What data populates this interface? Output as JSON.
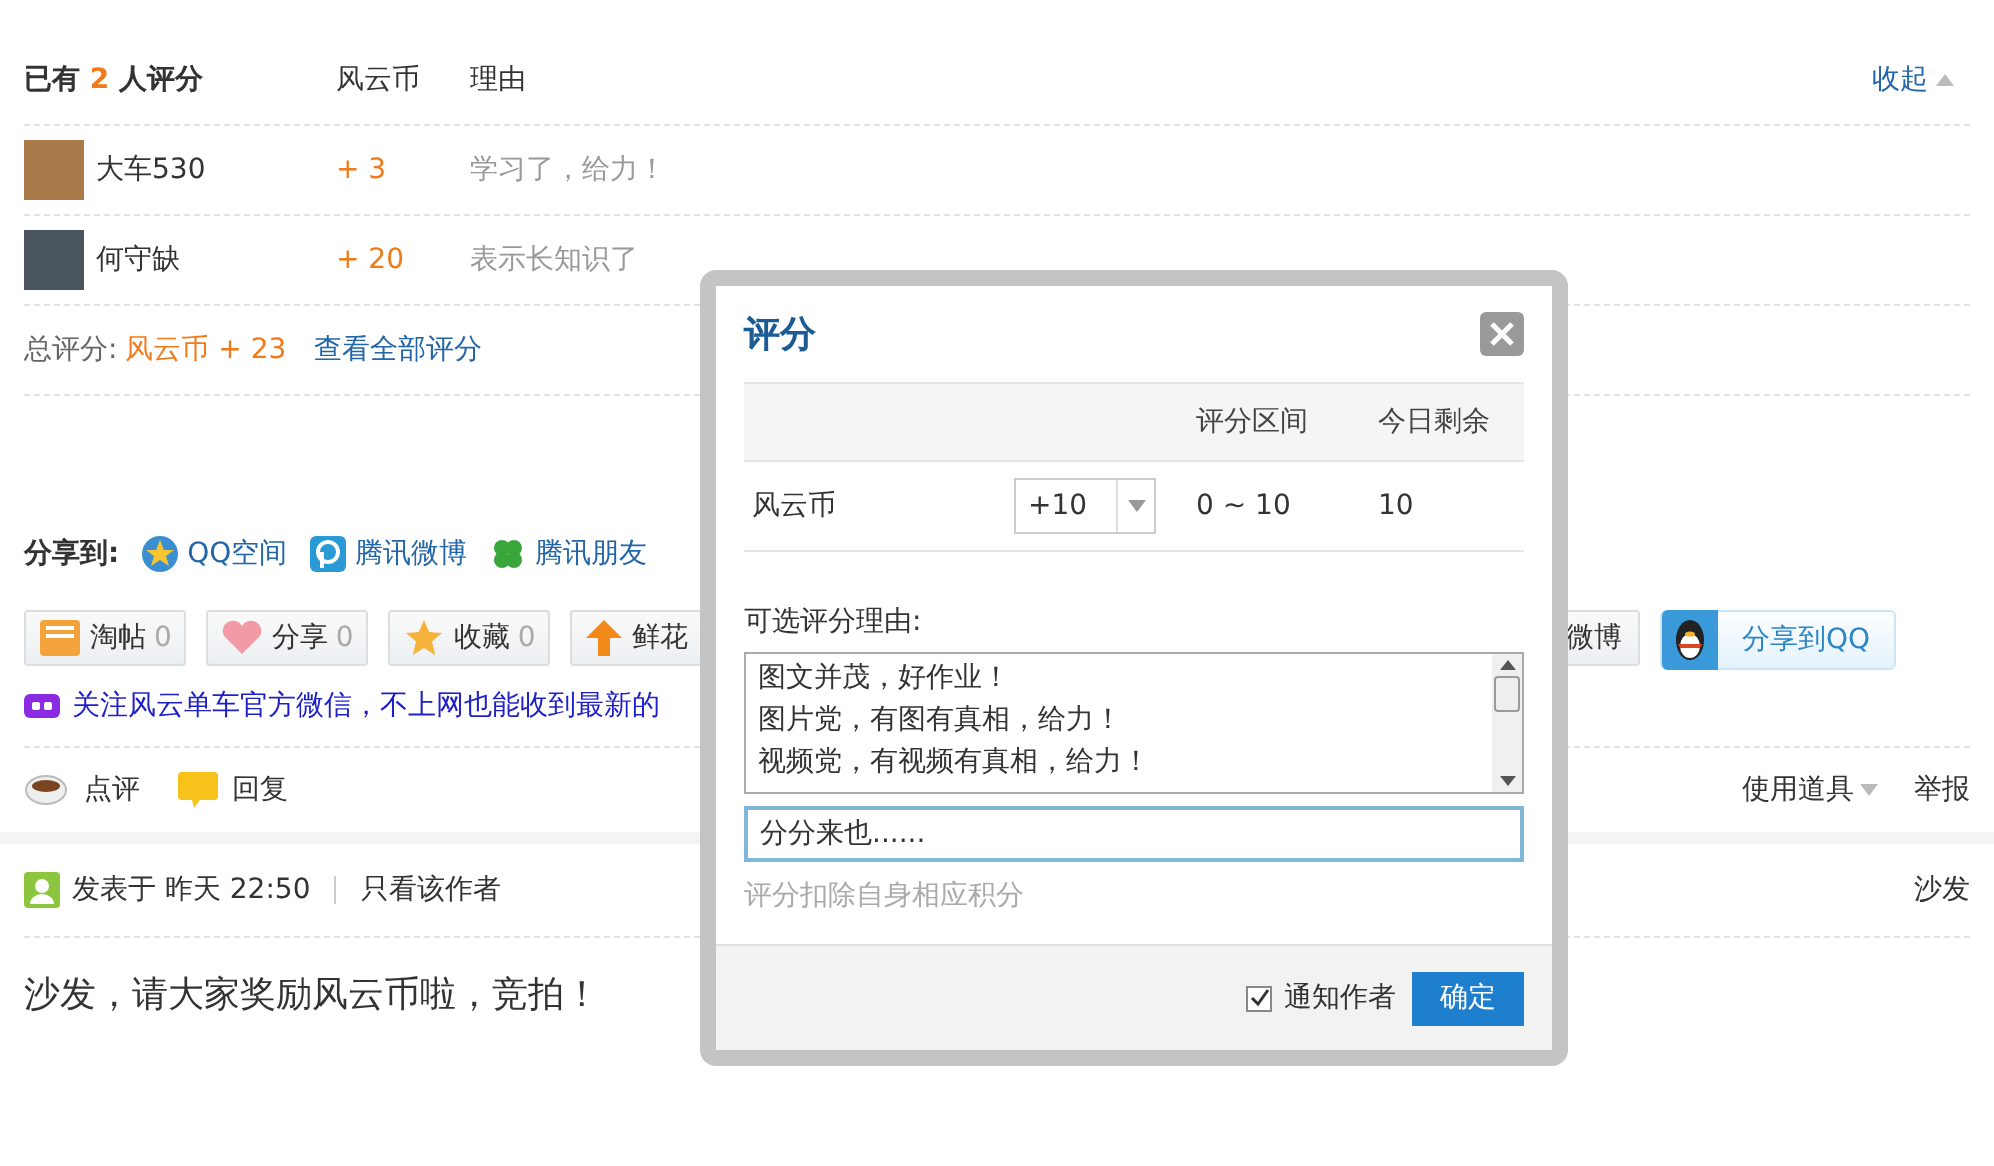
{
  "ratings": {
    "summary_before": "已有",
    "count": "2",
    "summary_after": "人评分",
    "columns": [
      "风云币",
      "理由"
    ],
    "collapse": "收起",
    "rows": [
      {
        "user": "大车530",
        "score": "+ 3",
        "reason": "学习了，给力！"
      },
      {
        "user": "何守缺",
        "score": "+ 20",
        "reason": "表示长知识了"
      }
    ],
    "total": {
      "label": "总评分:",
      "value": "风云币 + 23",
      "link": "查看全部评分"
    }
  },
  "share": {
    "label": "分享到:",
    "targets": [
      {
        "label": "QQ空间",
        "kind": "qzone"
      },
      {
        "label": "腾讯微博",
        "kind": "tweibo"
      },
      {
        "label": "腾讯朋友",
        "kind": "friends"
      }
    ]
  },
  "buttons": {
    "left": [
      {
        "label": "淘帖",
        "count": "0",
        "kind": "tray"
      },
      {
        "label": "分享",
        "count": "0",
        "kind": "heart"
      },
      {
        "label": "收藏",
        "count": "0",
        "kind": "star"
      },
      {
        "label": "鲜花",
        "kind": "up"
      }
    ],
    "right": [
      {
        "label": "微博",
        "kind": "plain"
      },
      {
        "label": "分享到QQ",
        "kind": "qq"
      }
    ]
  },
  "ad": "关注风云单车官方微信，不上网也能收到最新的",
  "post_actions": {
    "left": [
      {
        "label": "点评",
        "kind": "cup"
      },
      {
        "label": "回复",
        "kind": "bubble"
      }
    ],
    "right": [
      {
        "label": "使用道具",
        "kind": "menu"
      },
      {
        "label": "举报",
        "kind": "link"
      }
    ]
  },
  "post": {
    "meta": "发表于 昨天 22:50",
    "author_filter": "只看该作者",
    "floor": "沙发",
    "content": "沙发，请大家奖励风云币啦，竞拍！"
  },
  "dialog": {
    "title": "评分",
    "columns": [
      "评分区间",
      "今日剩余"
    ],
    "rows": [
      {
        "name": "风云币",
        "value": "+10",
        "range": "0 ~ 10",
        "remaining": "10"
      }
    ],
    "reasons_label": "可选评分理由:",
    "reasons": [
      "图文并茂，好作业！",
      "图片党，有图有真相，给力！",
      "视频党，有视频有真相，给力！"
    ],
    "reason_input": "分分来也......",
    "hint": "评分扣除自身相应积分",
    "notify": {
      "label": "通知作者",
      "checked": true
    },
    "confirm": "确定"
  }
}
